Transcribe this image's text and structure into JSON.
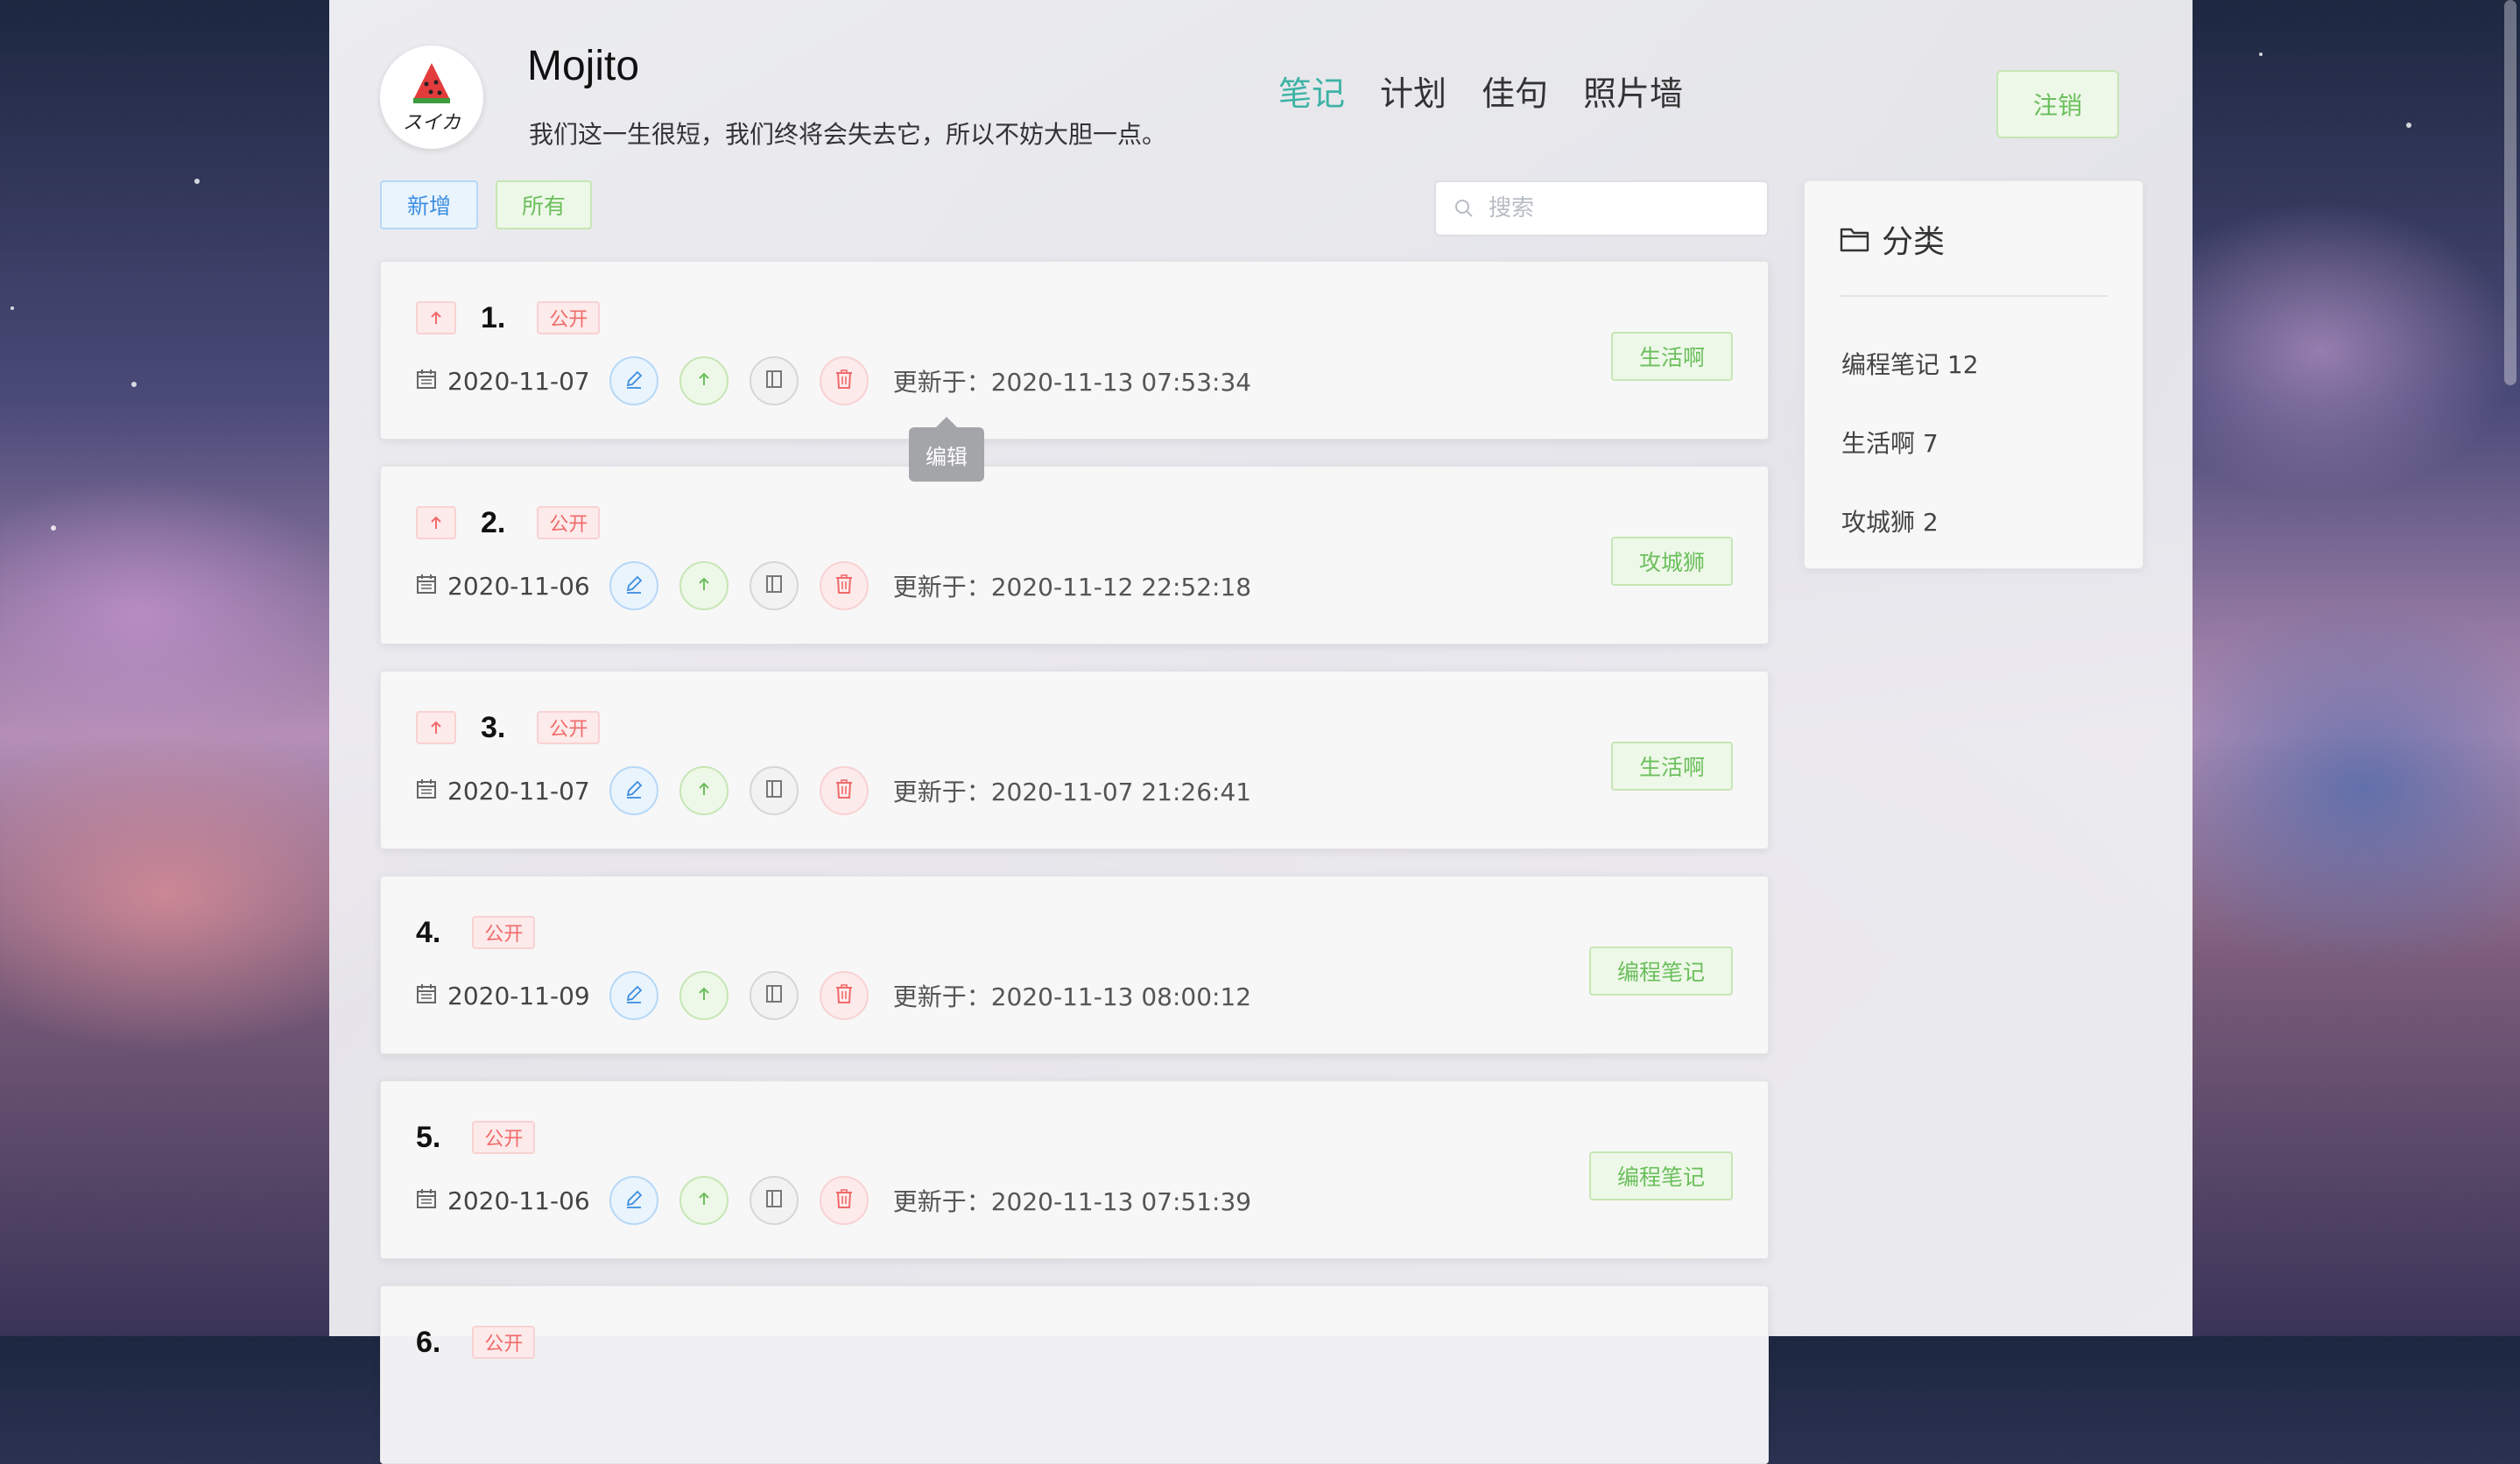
{
  "header": {
    "logo_text": "スイカ",
    "title": "Mojito",
    "motto": "我们这一生很短，我们终将会失去它，所以不妨大胆一点。",
    "nav": [
      "笔记",
      "计划",
      "佳句",
      "照片墙"
    ],
    "logout_label": "注销"
  },
  "toolbar": {
    "new_label": "新增",
    "all_label": "所有",
    "search_placeholder": "搜索"
  },
  "notes": [
    {
      "num": "1.",
      "pinned": true,
      "visibility": "公开",
      "date": "2020-11-07",
      "updated": "更新于：2020-11-13 07:53:34",
      "category": "生活啊"
    },
    {
      "num": "2.",
      "pinned": true,
      "visibility": "公开",
      "date": "2020-11-06",
      "updated": "更新于：2020-11-12 22:52:18",
      "category": "攻城狮"
    },
    {
      "num": "3.",
      "pinned": true,
      "visibility": "公开",
      "date": "2020-11-07",
      "updated": "更新于：2020-11-07 21:26:41",
      "category": "生活啊"
    },
    {
      "num": "4.",
      "pinned": false,
      "visibility": "公开",
      "date": "2020-11-09",
      "updated": "更新于：2020-11-13 08:00:12",
      "category": "编程笔记"
    },
    {
      "num": "5.",
      "pinned": false,
      "visibility": "公开",
      "date": "2020-11-06",
      "updated": "更新于：2020-11-13 07:51:39",
      "category": "编程笔记"
    },
    {
      "num": "6.",
      "pinned": false,
      "visibility": "公开",
      "date": "",
      "updated": "",
      "category": ""
    }
  ],
  "tooltip": "编辑",
  "sidebar": {
    "title": "分类",
    "items": [
      "编程笔记 12",
      "生活啊 7",
      "攻城狮 2"
    ]
  },
  "colors": {
    "accent": "#3fb3a6",
    "green": "#6bbf5c",
    "blue": "#3d8ee0",
    "red": "#ef6b6b"
  }
}
